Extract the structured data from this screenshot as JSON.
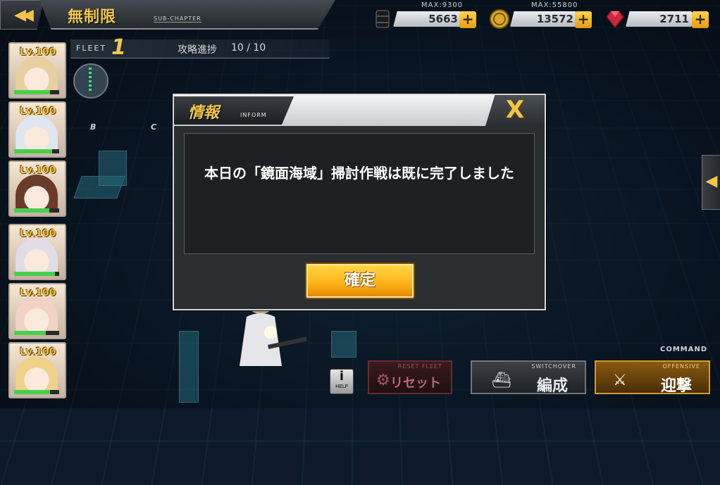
{
  "topbar": {
    "back_icon": "double-chevron-left-icon",
    "title": "無制限",
    "sub_chapter": "SUB-CHAPTER",
    "resources": [
      {
        "icon": "oil-barrel-icon",
        "max": "MAX:9300",
        "value": "5663"
      },
      {
        "icon": "gold-coin-icon",
        "max": "MAX:55800",
        "value": "13572"
      },
      {
        "icon": "gem-icon",
        "max": "",
        "value": "2711"
      }
    ],
    "plus": "+"
  },
  "fleet": {
    "label": "FLEET",
    "number": "1",
    "progress_label": "攻略進捗",
    "progress_value": "10 / 10"
  },
  "map_axis": [
    "B",
    "C"
  ],
  "cards": [
    {
      "level": "Lv.100",
      "hp": 0.8,
      "color": "#e8cfa0"
    },
    {
      "level": "Lv.100",
      "hp": 0.85,
      "color": "#dfe6ee"
    },
    {
      "level": "Lv.100",
      "hp": 0.78,
      "color": "#6b3b2c"
    },
    {
      "level": "Lv.100",
      "hp": 0.9,
      "color": "#e0dde6"
    },
    {
      "level": "Lv.100",
      "hp": 0.7,
      "color": "#f1d2c4"
    },
    {
      "level": "Lv.100",
      "hp": 0.8,
      "color": "#f0d18a"
    }
  ],
  "dialog": {
    "title": "情報",
    "subtitle": "INFORM",
    "close": "X",
    "message": "本日の「鏡面海域」掃討作戦は既に完了しました",
    "ok": "確定"
  },
  "bottom": {
    "help_icon": "i",
    "help_label": "HELP",
    "reset_tag": "RESET FLEET",
    "reset_label": "リセット",
    "command": "COMMAND",
    "switchover_tag": "SWITCHOVER",
    "formation_label": "編成",
    "offensive_tag": "OFFENSIVE",
    "engage_label": "迎撃"
  },
  "colors": {
    "accent_gold": "#f0c84a",
    "ok_button": "#ffb51a",
    "hp_green": "#48d04a"
  }
}
